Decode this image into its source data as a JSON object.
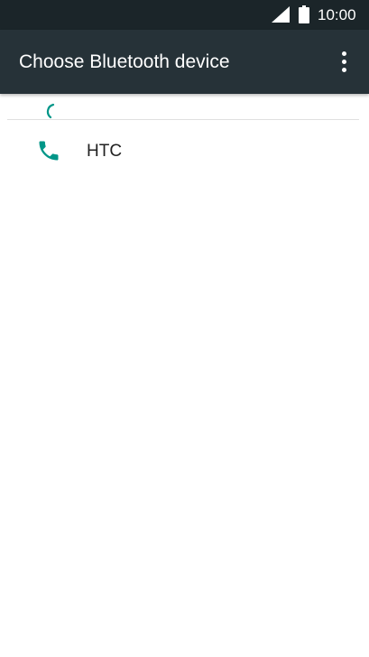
{
  "status_bar": {
    "time": "10:00",
    "icons": [
      "signal-icon",
      "battery-icon"
    ]
  },
  "app_bar": {
    "title": "Choose Bluetooth device",
    "overflow_icon": "more-vert-icon"
  },
  "progress": {
    "icon": "loading-spinner-icon"
  },
  "devices": [
    {
      "label": "HTC",
      "icon": "phone-icon"
    }
  ],
  "colors": {
    "status_bar_bg": "#1b2529",
    "app_bar_bg": "#263238",
    "accent": "#009688",
    "text_primary": "#212121"
  }
}
